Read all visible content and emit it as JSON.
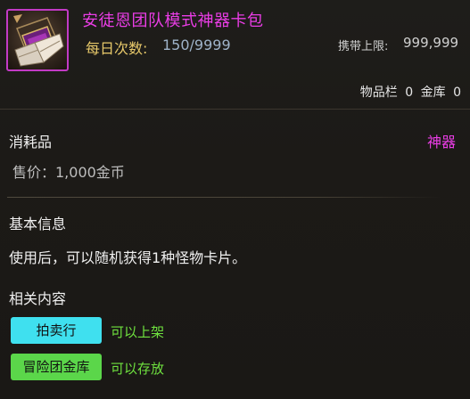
{
  "item": {
    "name": "安徒恩团队模式神器卡包",
    "icon": "card-pack-icon",
    "daily_label": "每日次数:",
    "daily_value": "150/9999",
    "carry_label": "携带上限:",
    "carry_value": "999,999",
    "storage": {
      "inventory_label": "物品栏",
      "inventory_count": "0",
      "vault_label": "金库",
      "vault_count": "0"
    }
  },
  "details": {
    "category": "消耗品",
    "rarity": "神器",
    "price": "售价：1,000金币"
  },
  "basic_info": {
    "title": "基本信息",
    "description": "使用后，可以随机获得1种怪物卡片。"
  },
  "related": {
    "title": "相关内容",
    "entries": [
      {
        "button": "拍卖行",
        "status": "可以上架"
      },
      {
        "button": "冒险团金库",
        "status": "可以存放"
      }
    ]
  },
  "colors": {
    "rarity": "#ea3de6",
    "gold_label": "#e8c96a",
    "auction_button": "#3fe0ef",
    "guild_button": "#5bd64a",
    "status_text": "#6fe23f"
  }
}
